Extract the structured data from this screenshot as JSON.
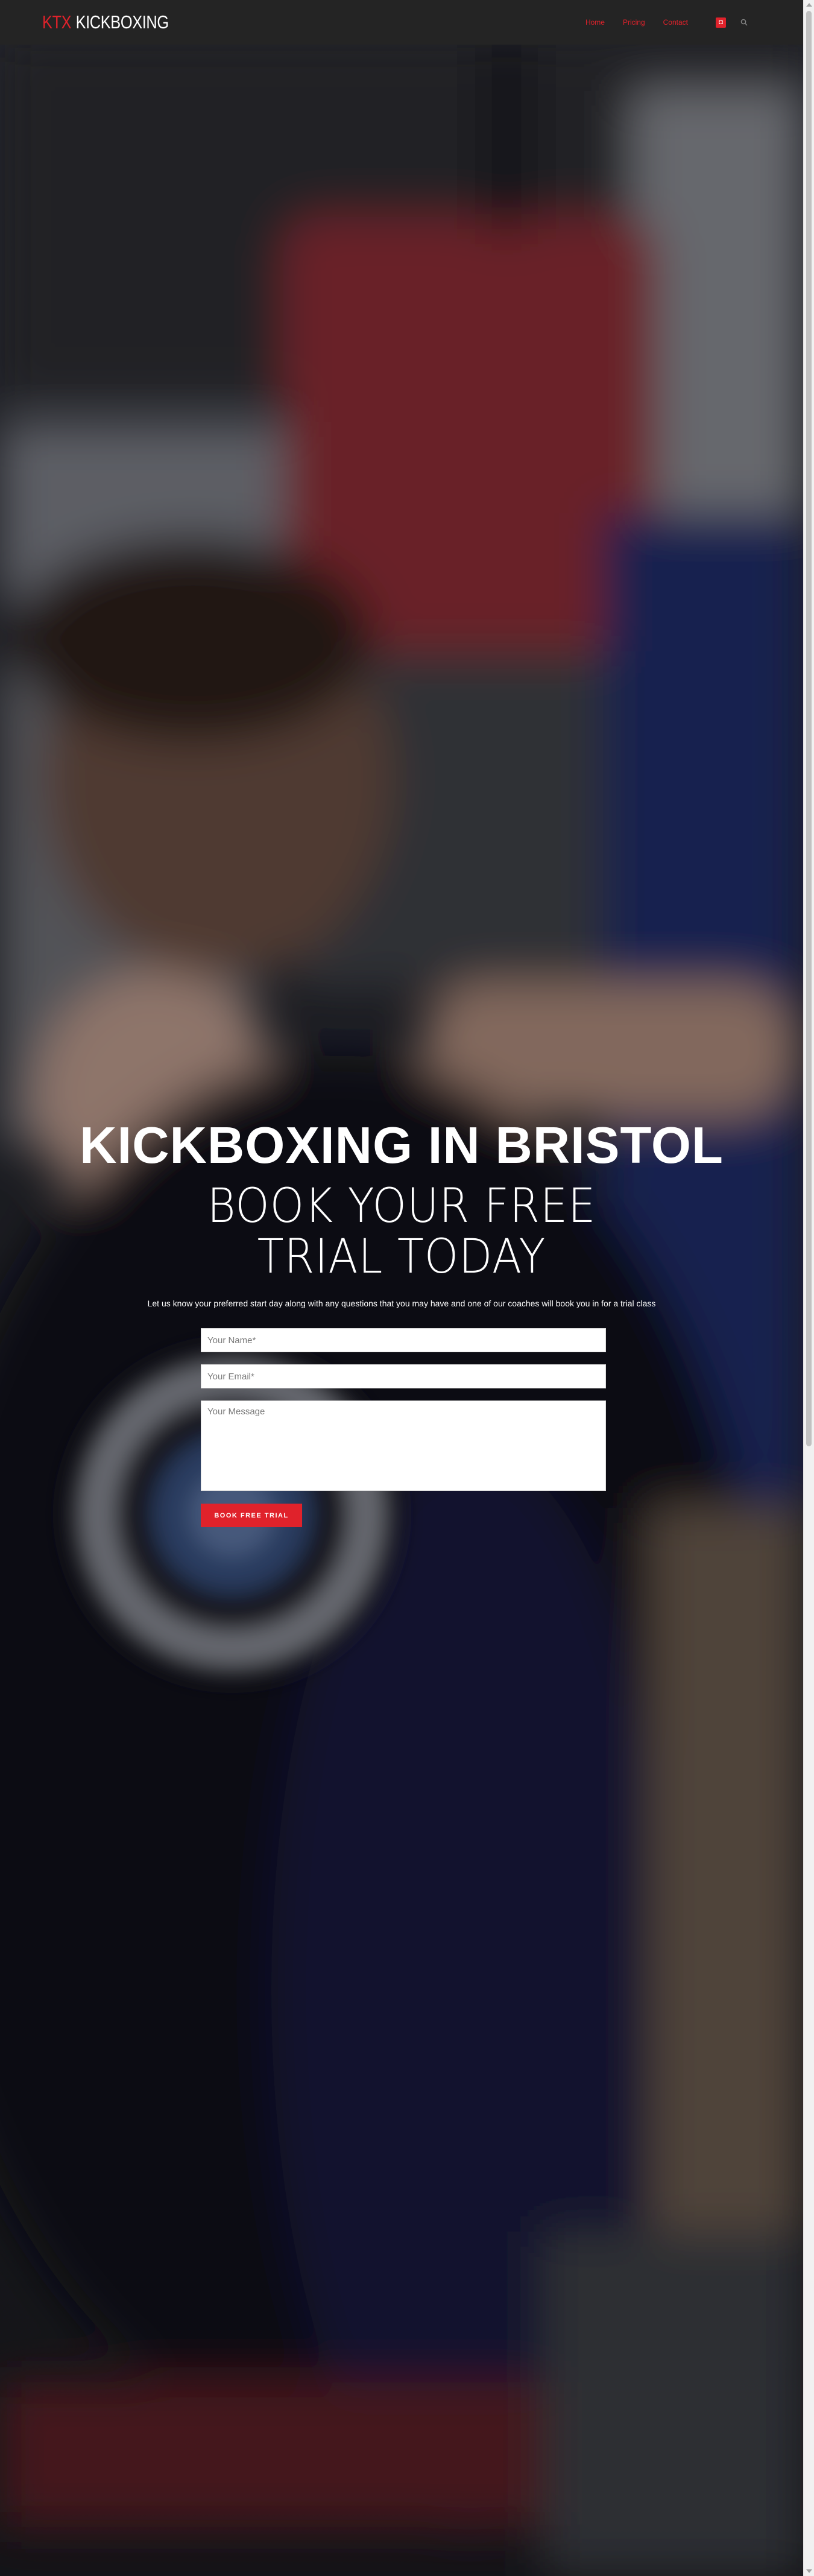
{
  "brand": {
    "logo_accent": "KTX",
    "logo_rest": "KICKBOXING",
    "accent_color": "#e0222b",
    "header_color": "#242424"
  },
  "nav": {
    "items": [
      {
        "label": "Home"
      },
      {
        "label": "Pricing"
      },
      {
        "label": "Contact"
      }
    ],
    "social_icon": "instagram-icon",
    "social_glyph": "◘",
    "search_icon": "search-icon"
  },
  "hero": {
    "title": "KICKBOXING IN BRISTOL",
    "subtitle": "BOOK YOUR FREE TRIAL TODAY",
    "intro": "Let us know your preferred start day along with any questions that you may have and one of our coaches will book you in for a trial class"
  },
  "form": {
    "name_placeholder": "Your Name*",
    "email_placeholder": "Your Email*",
    "message_placeholder": "Your Message",
    "submit_label": "BOOK FREE TRIAL"
  }
}
